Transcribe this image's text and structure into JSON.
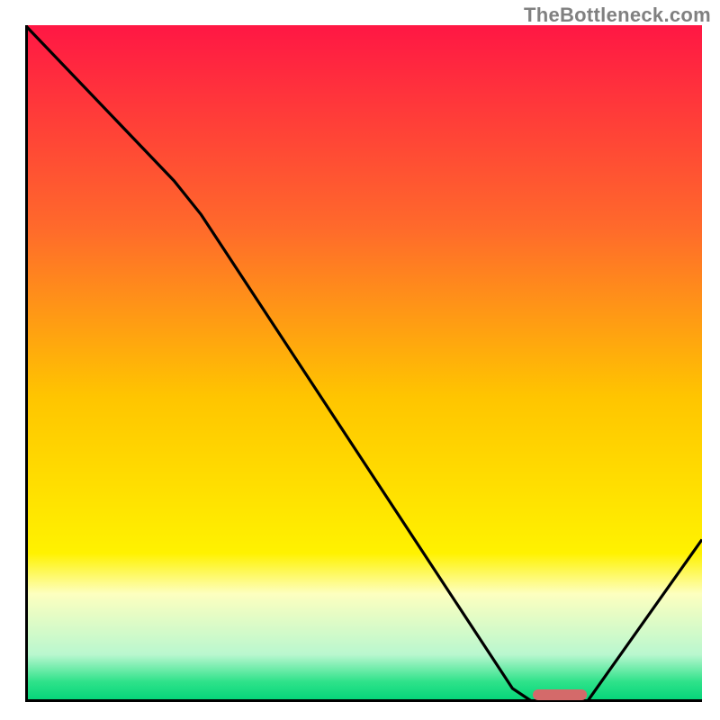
{
  "attribution": "TheBottleneck.com",
  "chart_data": {
    "type": "line",
    "title": "",
    "xlabel": "",
    "ylabel": "",
    "xlim": [
      0,
      100
    ],
    "ylim": [
      0,
      100
    ],
    "background_gradient": {
      "stops": [
        {
          "pct": 0.0,
          "color": "#ff1744"
        },
        {
          "pct": 0.3,
          "color": "#ff6a2b"
        },
        {
          "pct": 0.55,
          "color": "#ffc500"
        },
        {
          "pct": 0.78,
          "color": "#fff200"
        },
        {
          "pct": 0.84,
          "color": "#fdffbf"
        },
        {
          "pct": 0.93,
          "color": "#b9f7cf"
        },
        {
          "pct": 0.97,
          "color": "#2fe28a"
        },
        {
          "pct": 1.0,
          "color": "#00d478"
        }
      ]
    },
    "series": [
      {
        "name": "bottleneck-curve",
        "color": "#000000",
        "points": [
          {
            "x": 0,
            "y": 100
          },
          {
            "x": 22,
            "y": 77
          },
          {
            "x": 26,
            "y": 72
          },
          {
            "x": 72,
            "y": 2
          },
          {
            "x": 75,
            "y": 0
          },
          {
            "x": 83,
            "y": 0
          },
          {
            "x": 100,
            "y": 24
          }
        ]
      }
    ],
    "marker": {
      "name": "optimal-range",
      "color": "#d46a6a",
      "x_start": 75,
      "x_end": 83,
      "thickness": 12
    }
  }
}
